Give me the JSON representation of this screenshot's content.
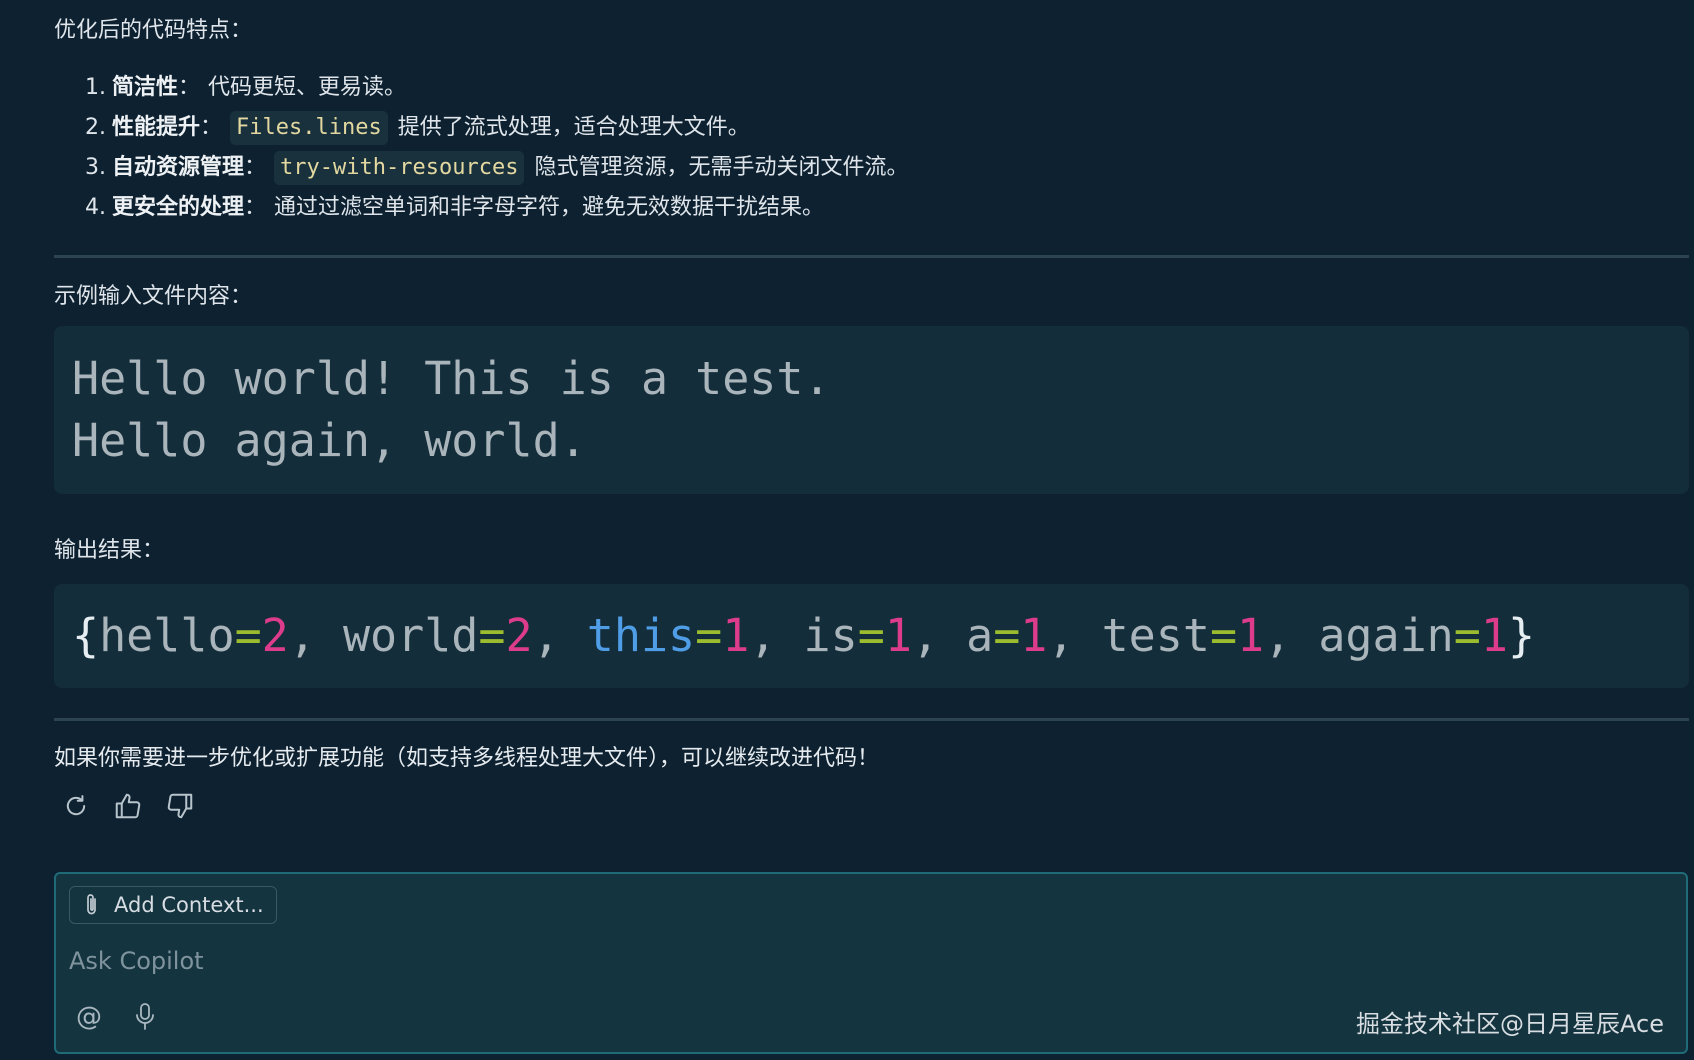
{
  "intro_heading": "优化后的代码特点：",
  "features": [
    {
      "num": "1.",
      "term": "简洁性",
      "sep": "：",
      "code": "",
      "desc": "代码更短、更易读。"
    },
    {
      "num": "2.",
      "term": "性能提升",
      "sep": "：",
      "code": "Files.lines",
      "desc": "提供了流式处理，适合处理大文件。"
    },
    {
      "num": "3.",
      "term": "自动资源管理",
      "sep": "：",
      "code": "try-with-resources",
      "desc": "隐式管理资源，无需手动关闭文件流。"
    },
    {
      "num": "4.",
      "term": "更安全的处理",
      "sep": "：",
      "code": "",
      "desc": "通过过滤空单词和非字母字符，避免无效数据干扰结果。"
    }
  ],
  "example_heading": "示例输入文件内容：",
  "example_lines": [
    "Hello world! This is a test.",
    "Hello again, world."
  ],
  "output_heading": "输出结果：",
  "output_tokens": [
    {
      "t": "{",
      "k": "p"
    },
    {
      "t": "hello",
      "k": "n"
    },
    {
      "t": "=",
      "k": "o"
    },
    {
      "t": "2",
      "k": "d"
    },
    {
      "t": ", ",
      "k": "n"
    },
    {
      "t": "world",
      "k": "n"
    },
    {
      "t": "=",
      "k": "o"
    },
    {
      "t": "2",
      "k": "d"
    },
    {
      "t": ", ",
      "k": "n"
    },
    {
      "t": "this",
      "k": "k"
    },
    {
      "t": "=",
      "k": "o"
    },
    {
      "t": "1",
      "k": "d"
    },
    {
      "t": ", ",
      "k": "n"
    },
    {
      "t": "is",
      "k": "n"
    },
    {
      "t": "=",
      "k": "o"
    },
    {
      "t": "1",
      "k": "d"
    },
    {
      "t": ", ",
      "k": "n"
    },
    {
      "t": "a",
      "k": "n"
    },
    {
      "t": "=",
      "k": "o"
    },
    {
      "t": "1",
      "k": "d"
    },
    {
      "t": ", ",
      "k": "n"
    },
    {
      "t": "test",
      "k": "n"
    },
    {
      "t": "=",
      "k": "o"
    },
    {
      "t": "1",
      "k": "d"
    },
    {
      "t": ", ",
      "k": "n"
    },
    {
      "t": "again",
      "k": "n"
    },
    {
      "t": "=",
      "k": "o"
    },
    {
      "t": "1",
      "k": "d"
    },
    {
      "t": "}",
      "k": "p"
    }
  ],
  "followup": "如果你需要进一步优化或扩展功能（如支持多线程处理大文件），可以继续改进代码！",
  "actions": [
    "refresh-icon",
    "thumbs-up-icon",
    "thumbs-down-icon"
  ],
  "chat": {
    "add_context_label": "Add Context...",
    "placeholder": "Ask Copilot",
    "watermark": "掘金技术社区@日月星辰Ace"
  },
  "colors": {
    "background": "#0d2130",
    "code_bg": "#142d3a",
    "keyword": "#4f9de6",
    "operator": "#9bbc2f",
    "number": "#dd3c8c"
  }
}
